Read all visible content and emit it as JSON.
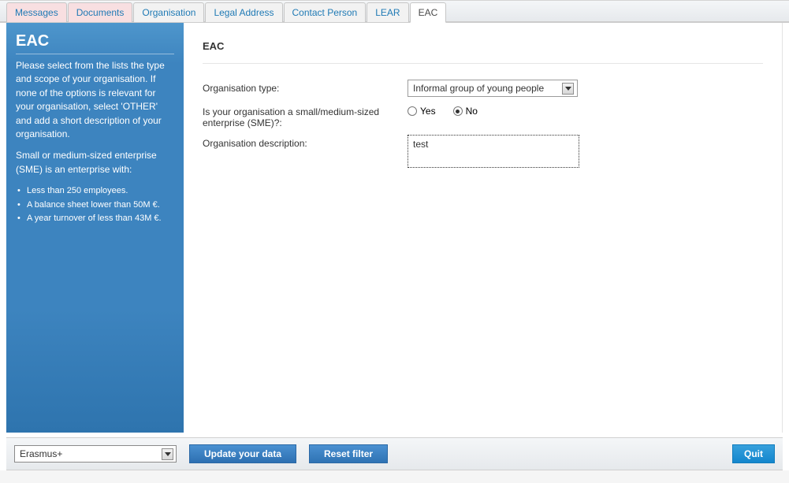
{
  "tabs": [
    {
      "label": "Messages",
      "style": "pink"
    },
    {
      "label": "Documents",
      "style": "pink"
    },
    {
      "label": "Organisation",
      "style": "normal"
    },
    {
      "label": "Legal Address",
      "style": "normal"
    },
    {
      "label": "Contact Person",
      "style": "normal"
    },
    {
      "label": "LEAR",
      "style": "normal"
    },
    {
      "label": "EAC",
      "style": "active"
    }
  ],
  "sidebar": {
    "title": "EAC",
    "para1": "Please select from the lists the type and scope of your organisation. If none of the options is relevant for your organisation, select 'OTHER' and add a short description of your organisation.",
    "para2": "Small or medium-sized enterprise (SME) is an enterprise with:",
    "bullets": [
      "Less than 250 employees.",
      "A balance sheet lower than 50M €.",
      "A year turnover of less than 43M €."
    ]
  },
  "main": {
    "heading": "EAC",
    "form": {
      "orgTypeLabel": "Organisation type:",
      "orgTypeValue": "Informal group of young people",
      "smeLabel": "Is your organisation a small/medium-sized enterprise (SME)?:",
      "radioYes": "Yes",
      "radioNo": "No",
      "smeSelected": "no",
      "descLabel": "Organisation description:",
      "descValue": "test"
    }
  },
  "footer": {
    "programSelect": "Erasmus+",
    "updateBtn": "Update your data",
    "resetBtn": "Reset filter",
    "quitBtn": "Quit"
  }
}
